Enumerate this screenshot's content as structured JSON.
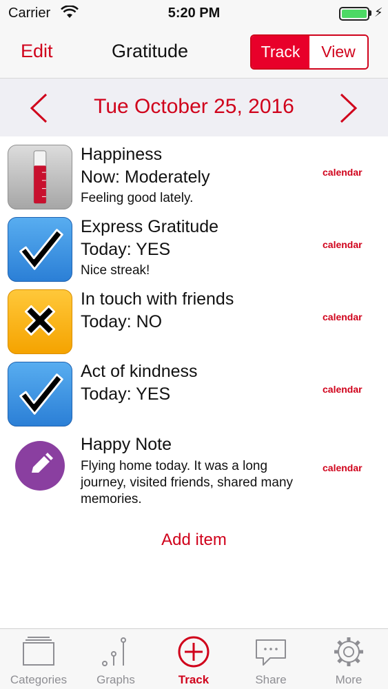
{
  "status_bar": {
    "carrier": "Carrier",
    "time": "5:20 PM",
    "battery_icon": "battery-full-icon",
    "battery_color": "#4cd964"
  },
  "nav": {
    "edit_label": "Edit",
    "title": "Gratitude",
    "segments": {
      "track": "Track",
      "view": "View"
    },
    "active_segment": "Track"
  },
  "date_bar": {
    "date": "Tue October 25, 2016",
    "prev_icon": "chevron-left-icon",
    "next_icon": "chevron-right-icon"
  },
  "items": [
    {
      "icon": "thermometer-gauge-icon",
      "title": "Happiness",
      "status": "Now: Moderately",
      "subtitle": "Feeling good lately.",
      "link": "calendar"
    },
    {
      "icon": "checkmark-icon",
      "title": "Express Gratitude",
      "status": "Today: YES",
      "subtitle": "Nice streak!",
      "link": "calendar"
    },
    {
      "icon": "cross-icon",
      "title": "In touch with friends",
      "status": "Today: NO",
      "link": "calendar"
    },
    {
      "icon": "checkmark-icon",
      "title": "Act of kindness",
      "status": "Today: YES",
      "link": "calendar"
    },
    {
      "icon": "pencil-icon",
      "title": "Happy Note",
      "note": "Flying home today. It was a long journey, visited friends, shared many memories.",
      "link": "calendar"
    }
  ],
  "add_item_label": "Add item",
  "tab_bar": {
    "tabs": [
      {
        "label": "Categories",
        "icon": "categories-icon"
      },
      {
        "label": "Graphs",
        "icon": "graphs-icon"
      },
      {
        "label": "Track",
        "icon": "plus-circle-icon"
      },
      {
        "label": "Share",
        "icon": "chat-bubble-icon"
      },
      {
        "label": "More",
        "icon": "gear-icon"
      }
    ],
    "active": "Track"
  },
  "colors": {
    "accent": "#d0021b",
    "segment_active": "#e8002a",
    "check_blue": "#2b7fd6",
    "cross_yellow": "#f5a300",
    "note_purple": "#8a3fa0"
  }
}
